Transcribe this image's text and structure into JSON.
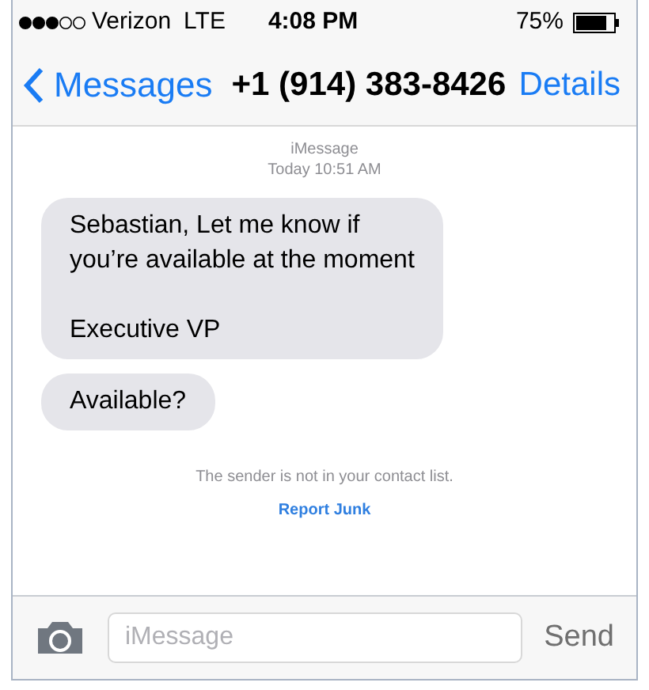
{
  "status_bar": {
    "carrier": "Verizon",
    "network": "LTE",
    "time": "4:08 PM",
    "battery": "75%"
  },
  "nav": {
    "back": "Messages",
    "title": "+1 (914) 383-8426",
    "action": "Details"
  },
  "thread": {
    "service": "iMessage",
    "timestamp": "Today 10:51 AM",
    "messages": [
      {
        "text": "Sebastian, Let me know if\nyou’re available at the moment\n\nExecutive VP"
      },
      {
        "text": "Available?"
      }
    ],
    "notice": "The sender is not in your contact list.",
    "report_link": "Report Junk"
  },
  "composer": {
    "placeholder": "iMessage",
    "send": "Send"
  }
}
